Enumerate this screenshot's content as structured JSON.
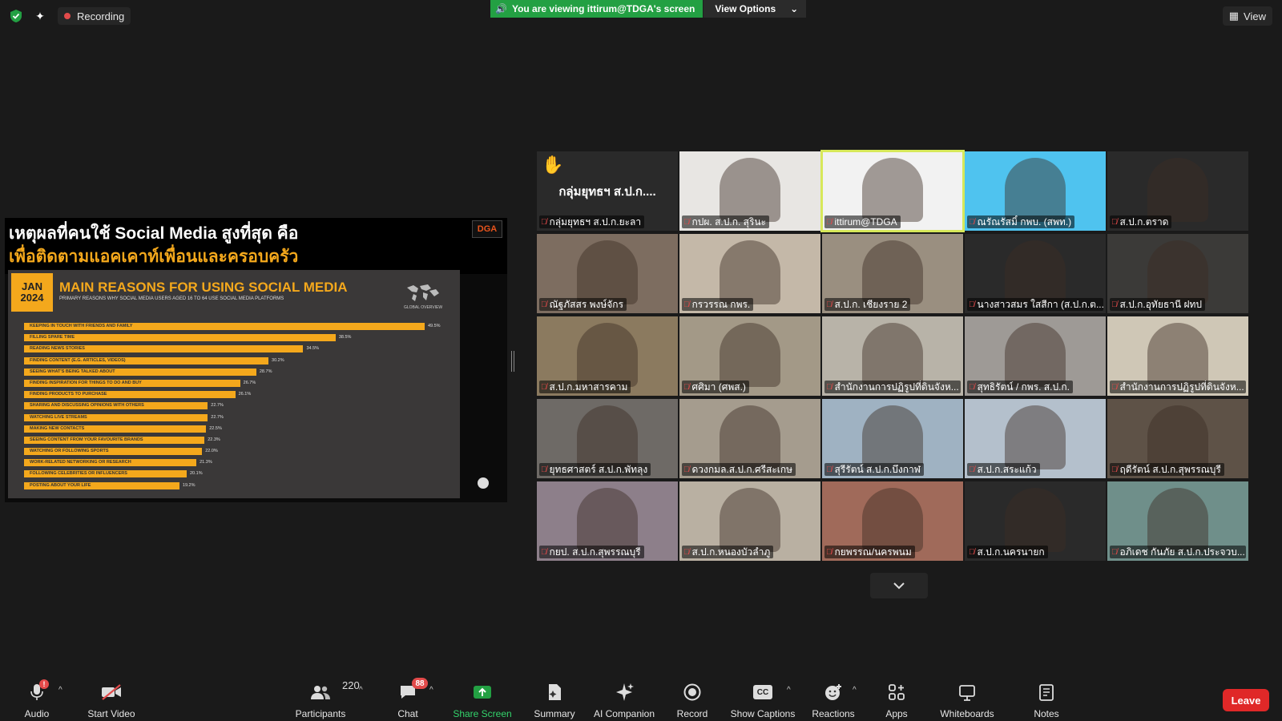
{
  "top": {
    "recording_label": "Recording",
    "viewing_banner": "You are viewing ittirum@TDGA's screen",
    "view_options_label": "View Options",
    "view_label": "View"
  },
  "shared_screen": {
    "heading_line1": "เหตุผลที่คนใช้ Social Media สูงที่สุด คือ",
    "heading_line2": "เพื่อติดตามแอคเคาท์เพื่อนและครอบครัว",
    "logo_text": "DGA",
    "slide": {
      "month": "JAN",
      "year": "2024",
      "title": "MAIN REASONS FOR USING SOCIAL MEDIA",
      "subtitle": "PRIMARY REASONS WHY SOCIAL MEDIA USERS AGED 16 TO 64 USE SOCIAL MEDIA PLATFORMS",
      "global_label": "GLOBAL OVERVIEW",
      "accent_color": "#f4a81c"
    }
  },
  "chart_data": {
    "type": "bar",
    "title": "MAIN REASONS FOR USING SOCIAL MEDIA",
    "xlim": [
      0,
      50
    ],
    "categories": [
      "KEEPING IN TOUCH WITH FRIENDS AND FAMILY",
      "FILLING SPARE TIME",
      "READING NEWS STORIES",
      "FINDING CONTENT (E.G. ARTICLES, VIDEOS)",
      "SEEING WHAT'S BEING TALKED ABOUT",
      "FINDING INSPIRATION FOR THINGS TO DO AND BUY",
      "FINDING PRODUCTS TO PURCHASE",
      "SHARING AND DISCUSSING OPINIONS WITH OTHERS",
      "WATCHING LIVE STREAMS",
      "MAKING NEW CONTACTS",
      "SEEING CONTENT FROM YOUR FAVOURITE BRANDS",
      "WATCHING OR FOLLOWING SPORTS",
      "WORK-RELATED NETWORKING OR RESEARCH",
      "FOLLOWING CELEBRITIES OR INFLUENCERS",
      "POSTING ABOUT YOUR LIFE"
    ],
    "values": [
      49.5,
      38.5,
      34.5,
      30.2,
      28.7,
      26.7,
      26.1,
      22.7,
      22.7,
      22.5,
      22.3,
      22.0,
      21.3,
      20.1,
      19.2
    ],
    "value_labels": [
      "49.5%",
      "38.5%",
      "34.5%",
      "30.2%",
      "28.7%",
      "26.7%",
      "26.1%",
      "22.7%",
      "22.7%",
      "22.5%",
      "22.3%",
      "22.0%",
      "21.3%",
      "20.1%",
      "19.2%"
    ]
  },
  "participants": [
    {
      "name": "กลุ่มยุทธฯ ส.ป.ก.ยะลา",
      "big_name": "กลุ่มยุทธฯ ส.ป.ก....",
      "hand": true,
      "color": "#2a2a2a"
    },
    {
      "name": "กปผ. ส.ป.ก. สุรินะ",
      "color": "#e8e6e3"
    },
    {
      "name": "ittirum@TDGA",
      "active": true,
      "color": "#f2f2f2"
    },
    {
      "name": "ณรัณรัสมิ์ กพบ. (สพท.)",
      "color": "#4fc3ef"
    },
    {
      "name": "ส.ป.ก.ตราด",
      "color": "#2a2a2a"
    },
    {
      "name": "ณัฐภัสสร พงษ์จักร",
      "color": "#7d6d60"
    },
    {
      "name": "กรวรรณ กพร.",
      "color": "#c4b8a8"
    },
    {
      "name": "ส.ป.ก. เชียงราย 2",
      "color": "#9a8f80"
    },
    {
      "name": "นางสาวสมร ใสสีกา (ส.ป.ก.ต...",
      "color": "#2a2a2a"
    },
    {
      "name": "ส.ป.ก.อุทัยธานี ฝทป",
      "color": "#3b3a38"
    },
    {
      "name": "ส.ป.ก.มหาสารคาม",
      "color": "#8b7a5f"
    },
    {
      "name": "ศศิมา (ศพส.)",
      "color": "#a39987"
    },
    {
      "name": "สำนักงานการปฏิรูปที่ดินจังห...",
      "color": "#b8b3a8"
    },
    {
      "name": "สุทธิรัตน์ / กพร. ส.ป.ก.",
      "color": "#9e9a96"
    },
    {
      "name": "สำนักงานการปฏิรูปที่ดินจังห...",
      "color": "#cfc7b6"
    },
    {
      "name": "ยุทธศาสตร์ ส.ป.ก.พัทลุง",
      "color": "#6e6a66"
    },
    {
      "name": "ดวงกมล.ส.ป.ก.ศรีสะเกษ",
      "color": "#a59c8e"
    },
    {
      "name": "สุรีรัตน์ ส.ป.ก.บึงกาฬ",
      "color": "#9fb2c2"
    },
    {
      "name": "ส.ป.ก.สระแก้ว",
      "color": "#b4c0cc"
    },
    {
      "name": "ฤดีรัตน์ ส.ป.ก.สุพรรณบุรี",
      "color": "#5e5247"
    },
    {
      "name": "กยป. ส.ป.ก.สุพรรณบุรี",
      "color": "#8d7f8a"
    },
    {
      "name": "ส.ป.ก.หนองบัวลำภู",
      "color": "#b9b0a2"
    },
    {
      "name": "กยพรรณ/นครพนม",
      "color": "#a06a5a"
    },
    {
      "name": "ส.ป.ก.นครนายก",
      "color": "#2a2a2a"
    },
    {
      "name": "อภิเดช กันภัย ส.ป.ก.ประจวบ...",
      "color": "#6f8f8a"
    }
  ],
  "toolbar": {
    "audio": "Audio",
    "audio_alert": "!",
    "video": "Start Video",
    "participants_count": "220",
    "participants": "Participants",
    "chat": "Chat",
    "chat_badge": "88",
    "share": "Share Screen",
    "summary": "Summary",
    "ai": "AI Companion",
    "record": "Record",
    "captions": "Show Captions",
    "cc": "CC",
    "reactions": "Reactions",
    "apps": "Apps",
    "whiteboards": "Whiteboards",
    "notes": "Notes",
    "leave": "Leave"
  }
}
